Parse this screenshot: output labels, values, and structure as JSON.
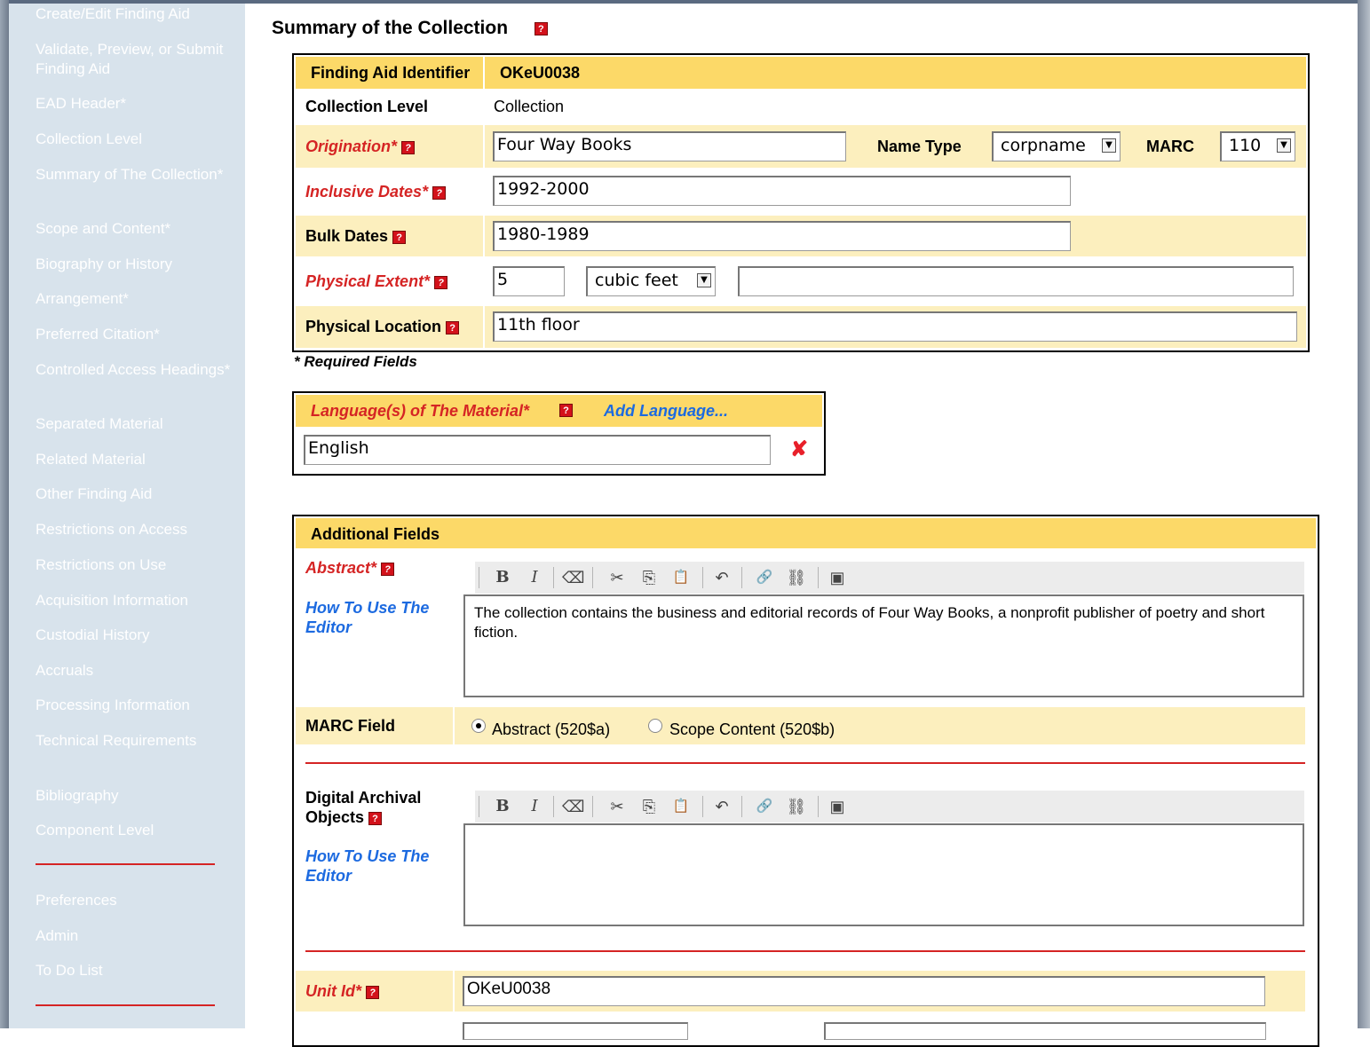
{
  "sidebar": {
    "items": [
      "Create/Edit Finding Aid",
      "Validate, Preview, or Submit Finding Aid",
      "EAD Header*",
      "Collection Level",
      "Summary of The Collection*",
      "Scope and Content*",
      "Biography or History",
      "Arrangement*",
      "Preferred Citation*",
      "Controlled Access Headings*",
      "Separated Material",
      "Related Material",
      "Other Finding Aid",
      "Restrictions on Access",
      "Restrictions on Use",
      "Acquisition Information",
      "Custodial History",
      "Accruals",
      "Processing Information",
      "Technical Requirements",
      "Bibliography",
      "Component Level"
    ],
    "bottom_items": [
      "Preferences",
      "Admin",
      "To Do List"
    ]
  },
  "page": {
    "title": "Summary of the Collection"
  },
  "summary": {
    "finding_aid_label": "Finding Aid Identifier",
    "finding_aid_value": "OKeU0038",
    "collection_level_label": "Collection Level",
    "collection_level_value": "Collection",
    "origination_label": "Origination*",
    "origination_value": "Four Way Books",
    "name_type_label": "Name Type",
    "name_type_value": "corpname",
    "marc_label": "MARC",
    "marc_value": "110",
    "inclusive_dates_label": "Inclusive Dates*",
    "inclusive_dates_value": "1992-2000",
    "bulk_dates_label": "Bulk Dates",
    "bulk_dates_value": "1980-1989",
    "physical_extent_label": "Physical Extent*",
    "physical_extent_value": "5",
    "physical_extent_unit": "cubic feet",
    "physical_extent_extra": "",
    "physical_location_label": "Physical Location",
    "physical_location_value": "11th floor",
    "required_note": "* Required Fields"
  },
  "language": {
    "header_label": "Language(s) of The Material*",
    "add_label": "Add Language...",
    "value": "English"
  },
  "additional": {
    "header": "Additional Fields",
    "abstract_label": "Abstract*",
    "how_to_label": "How To Use The Editor",
    "abstract_text": "The collection contains the business and editorial records of Four Way Books, a nonprofit publisher of poetry and short fiction.",
    "marc_field_label": "MARC Field",
    "radio_abstract": "Abstract (520$a)",
    "radio_scope": "Scope Content (520$b)",
    "dao_label": "Digital Archival Objects",
    "dao_text": "",
    "unit_id_label": "Unit Id*",
    "unit_id_value": "OKeU0038"
  },
  "icons": {
    "help": "?",
    "remove": "✘",
    "bold": "B",
    "italic": "I",
    "eraser": "⌫",
    "cut": "✂",
    "copy": "⎘",
    "paste": "📋",
    "undo": "↶",
    "link": "🔗",
    "unlink": "⛓",
    "image": "▣",
    "dropdown": "▼"
  }
}
